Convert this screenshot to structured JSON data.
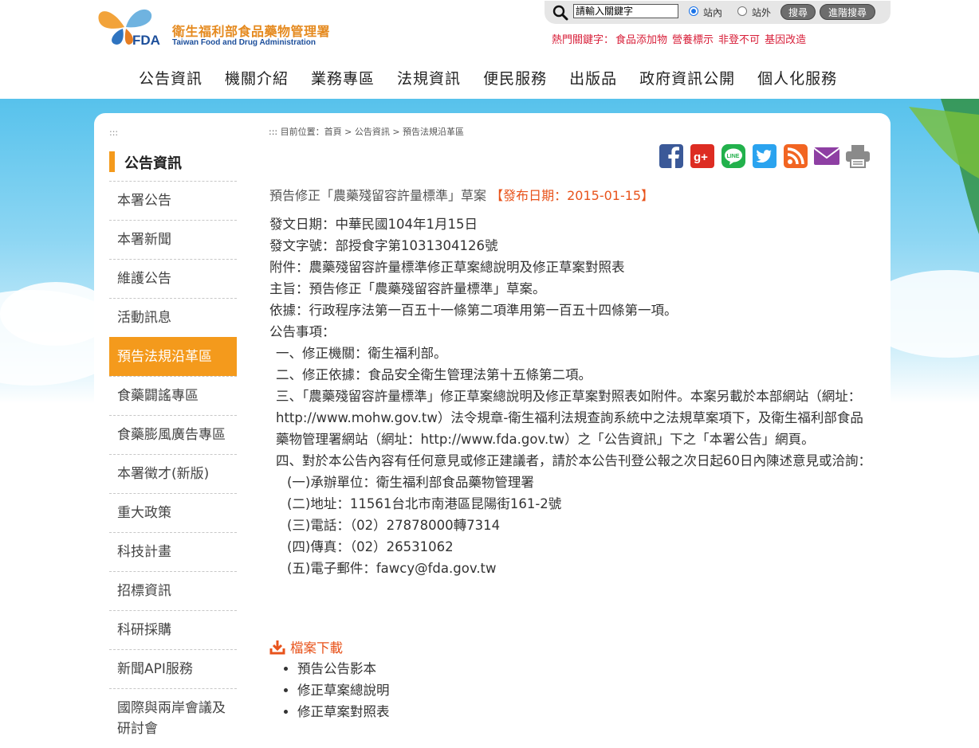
{
  "header": {
    "logo_zh": "衛生福利部食品藥物管理署",
    "logo_en": "Taiwan Food and Drug Administration",
    "logo_fda": "FDA",
    "search": {
      "input_value": "請輸入關鍵字",
      "scope_inside": "站內",
      "scope_outside": "站外",
      "search_button": "搜尋",
      "advanced_button": "進階搜尋"
    },
    "hot_label": "熱門關鍵字：",
    "hot_keywords": [
      "食品添加物",
      "營養標示",
      "非登不可",
      "基因改造"
    ]
  },
  "nav": [
    "公告資訊",
    "機關介紹",
    "業務專區",
    "法規資訊",
    "便民服務",
    "出版品",
    "政府資訊公開",
    "個人化服務"
  ],
  "sidebar": {
    "dots": ":::",
    "title": "公告資訊",
    "items": [
      "本署公告",
      "本署新聞",
      "維護公告",
      "活動訊息",
      "預告法規沿革區",
      "食藥闢謠專區",
      "食藥膨風廣告專區",
      "本署徵才(新版)",
      "重大政策",
      "科技計畫",
      "招標資訊",
      "科研採購",
      "新聞API服務",
      "國際與兩岸會議及研討會"
    ],
    "active_index": 4
  },
  "breadcrumb": "::: 目前位置：首頁 > 公告資訊 > 預告法規沿革區",
  "share_icons": [
    "facebook-icon",
    "google-plus-icon",
    "line-icon",
    "twitter-icon",
    "rss-icon",
    "email-icon",
    "print-icon"
  ],
  "article": {
    "title": "預告修正「農藥殘留容許量標準」草案",
    "date": "【發布日期：2015-01-15】",
    "lines": [
      "發文日期：中華民國104年1月15日",
      "發文字號：部授食字第1031304126號",
      "附件：農藥殘留容許量標準修正草案總說明及修正草案對照表",
      "主旨：預告修正「農藥殘留容許量標準」草案。",
      "依據：行政程序法第一百五十一條第二項準用第一百五十四條第一項。",
      "公告事項："
    ],
    "items": [
      "一、修正機關：衛生福利部。",
      "二、修正依據：食品安全衛生管理法第十五條第二項。",
      "三、「農藥殘留容許量標準」修正草案總說明及修正草案對照表如附件。本案另載於本部網站（網址：http://www.mohw.gov.tw）法令規章-衛生福利法規查詢系統中之法規草案項下，及衛生福利部食品藥物管理署網站（網址：http://www.fda.gov.tw）之「公告資訊」下之「本署公告」網頁。",
      "四、對於本公告內容有任何意見或修正建議者，請於本公告刊登公報之次日起60日內陳述意見或洽詢："
    ],
    "contacts": [
      "(一)承辦單位：衛生福利部食品藥物管理署",
      "(二)地址：11561台北市南港區昆陽街161-2號",
      "(三)電話：（02）27878000轉7314",
      "(四)傳真：（02）26531062",
      "(五)電子郵件：fawcy@fda.gov.tw"
    ],
    "download_label": "檔案下載",
    "downloads": [
      "預告公告影本",
      "修正草案總說明",
      "修正草案對照表"
    ]
  },
  "colors": {
    "accent": "#f49a1c",
    "date_red": "#e8531b",
    "hot_red": "#d8203a"
  }
}
